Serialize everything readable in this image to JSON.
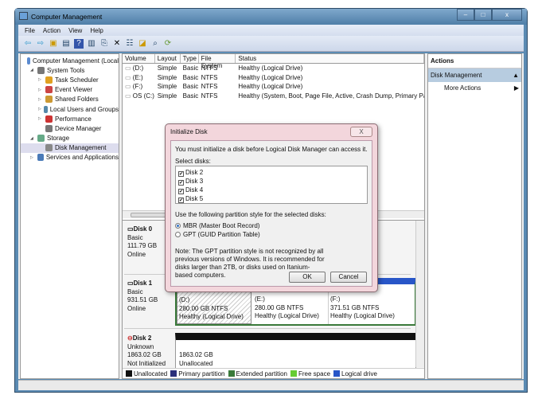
{
  "window": {
    "title": "Computer Management",
    "min": "–",
    "max": "□",
    "close": "x"
  },
  "menu": [
    "File",
    "Action",
    "View",
    "Help"
  ],
  "toolbar_icons": [
    "back-icon",
    "forward-icon",
    "up-folder-icon",
    "show-hide-tree-icon",
    "help-icon",
    "show-hide-action-icon",
    "export-icon",
    "delete-icon",
    "properties-icon",
    "open-icon",
    "search-icon",
    "rescan-icon"
  ],
  "tree": [
    {
      "label": "Computer Management (Local",
      "level": 0
    },
    {
      "label": "System Tools",
      "level": 1
    },
    {
      "label": "Task Scheduler",
      "level": 2
    },
    {
      "label": "Event Viewer",
      "level": 2
    },
    {
      "label": "Shared Folders",
      "level": 2
    },
    {
      "label": "Local Users and Groups",
      "level": 2
    },
    {
      "label": "Performance",
      "level": 2
    },
    {
      "label": "Device Manager",
      "level": 2
    },
    {
      "label": "Storage",
      "level": 1
    },
    {
      "label": "Disk Management",
      "level": 2
    },
    {
      "label": "Services and Applications",
      "level": 1
    }
  ],
  "volumes": {
    "headers": [
      "Volume",
      "Layout",
      "Type",
      "File System",
      "Status"
    ],
    "rows": [
      [
        "(D:)",
        "Simple",
        "Basic",
        "NTFS",
        "Healthy (Logical Drive)"
      ],
      [
        "(E:)",
        "Simple",
        "Basic",
        "NTFS",
        "Healthy (Logical Drive)"
      ],
      [
        "(F:)",
        "Simple",
        "Basic",
        "NTFS",
        "Healthy (Logical Drive)"
      ],
      [
        "OS  (C:)",
        "Simple",
        "Basic",
        "NTFS",
        "Healthy (System, Boot, Page File, Active, Crash Dump, Primary Partitic"
      ]
    ]
  },
  "disks": [
    {
      "name": "Disk 0",
      "type": "Basic",
      "size": "111.79 GB",
      "state": "Online"
    },
    {
      "name": "Disk 1",
      "type": "Basic",
      "size": "931.51 GB",
      "state": "Online",
      "partitions": [
        {
          "label": "(D:)",
          "size": "280.00 GB NTFS",
          "status": "Healthy (Logical Drive)"
        },
        {
          "label": "(E:)",
          "size": "280.00 GB NTFS",
          "status": "Healthy (Logical Drive)"
        },
        {
          "label": "(F:)",
          "size": "371.51 GB NTFS",
          "status": "Healthy (Logical Drive)"
        }
      ]
    },
    {
      "name": "Disk 2",
      "type": "Unknown",
      "size": "1863.02 GB",
      "state": "Not Initialized",
      "unalloc_size": "1863.02 GB",
      "unalloc_label": "Unallocated"
    }
  ],
  "legend": [
    {
      "label": "Unallocated",
      "color": "#111111"
    },
    {
      "label": "Primary partition",
      "color": "#2b2f7a"
    },
    {
      "label": "Extended partition",
      "color": "#3a7a3a"
    },
    {
      "label": "Free space",
      "color": "#66cc33"
    },
    {
      "label": "Logical drive",
      "color": "#2856c8"
    }
  ],
  "actions": {
    "title": "Actions",
    "section": "Disk Management",
    "item": "More Actions"
  },
  "dialog": {
    "title": "Initialize Disk",
    "close": "X",
    "message": "You must initialize a disk before Logical Disk Manager can access it.",
    "select_label": "Select disks:",
    "disks": [
      "Disk 2",
      "Disk 3",
      "Disk 4",
      "Disk 5"
    ],
    "style_label": "Use the following partition style for the selected disks:",
    "options": [
      "MBR (Master Boot Record)",
      "GPT (GUID Partition Table)"
    ],
    "note": "Note: The GPT partition style is not recognized by all previous versions of Windows. It is recommended for disks larger than 2TB, or disks used on Itanium-based computers.",
    "ok": "OK",
    "cancel": "Cancel"
  }
}
